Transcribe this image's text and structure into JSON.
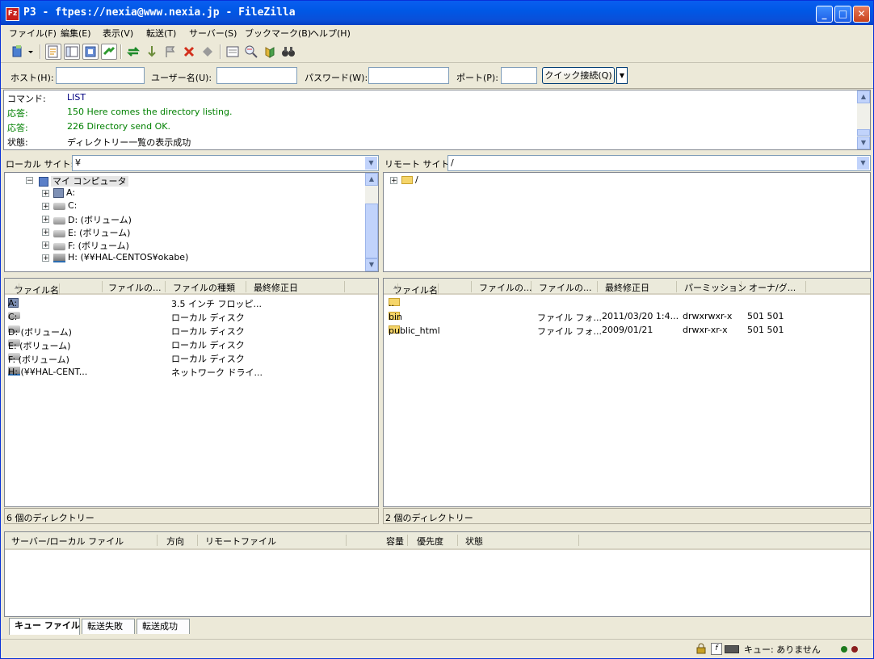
{
  "window": {
    "title": "P3 - ftpes://nexia@www.nexia.jp - FileZilla",
    "app_icon": "Fz"
  },
  "menu": [
    "ファイル(F)",
    "編集(E)",
    "表示(V)",
    "転送(T)",
    "サーバー(S)",
    "ブックマーク(B)",
    "ヘルプ(H)"
  ],
  "quickconnect": {
    "host_label": "ホスト(H):",
    "host_value": "",
    "user_label": "ユーザー名(U):",
    "user_value": "",
    "pass_label": "パスワード(W):",
    "pass_value": "",
    "port_label": "ポート(P):",
    "port_value": "",
    "connect_label": "クイック接続(Q)"
  },
  "log": [
    {
      "label": "コマンド:",
      "message": "LIST",
      "color": "#000080"
    },
    {
      "label": "応答:",
      "message": "150 Here comes the directory listing.",
      "color": "#008000"
    },
    {
      "label": "応答:",
      "message": "226 Directory send OK.",
      "color": "#008000"
    },
    {
      "label": "状態:",
      "message": "ディレクトリー一覧の表示成功",
      "color": "#000000"
    }
  ],
  "local": {
    "site_label": "ローカル サイト:",
    "site_value": "¥",
    "tree_root": "マイ コンピュータ",
    "tree": [
      "A:",
      "C:",
      "D: (ボリューム)",
      "E: (ボリューム)",
      "F: (ボリューム)",
      "H: (¥¥HAL-CENTOS¥okabe)"
    ],
    "columns": [
      "ファイル名",
      "ファイルの...",
      "ファイルの種類",
      "最終修正日"
    ],
    "files": [
      {
        "name": "A:",
        "type": "3.5 インチ フロッピ..."
      },
      {
        "name": "C:",
        "type": "ローカル ディスク"
      },
      {
        "name": "D: (ボリューム)",
        "type": "ローカル ディスク"
      },
      {
        "name": "E: (ボリューム)",
        "type": "ローカル ディスク"
      },
      {
        "name": "F: (ボリューム)",
        "type": "ローカル ディスク"
      },
      {
        "name": "H: (¥¥HAL-CENT...",
        "type": "ネットワーク ドライ..."
      }
    ],
    "status": "6 個のディレクトリー"
  },
  "remote": {
    "site_label": "リモート サイト:",
    "site_value": "/",
    "tree_root": "/",
    "columns": [
      "ファイル名",
      "ファイルの...",
      "ファイルの...",
      "最終修正日",
      "パーミッション",
      "オーナ/グ..."
    ],
    "files": [
      {
        "name": "..",
        "type": "",
        "modified": "",
        "perm": "",
        "owner": ""
      },
      {
        "name": "bin",
        "type": "ファイル フォ...",
        "modified": "2011/03/20 1:4...",
        "perm": "drwxrwxr-x",
        "owner": "501 501"
      },
      {
        "name": "public_html",
        "type": "ファイル フォ...",
        "modified": "2009/01/21",
        "perm": "drwxr-xr-x",
        "owner": "501 501"
      }
    ],
    "status": "2 個のディレクトリー"
  },
  "queue": {
    "columns": [
      "サーバー/ローカル ファイル",
      "方向",
      "リモートファイル",
      "容量",
      "優先度",
      "状態"
    ],
    "tabs": [
      "キュー ファイル",
      "転送失敗",
      "転送成功"
    ]
  },
  "statusbar": {
    "queue_text": "キュー: ありません"
  }
}
